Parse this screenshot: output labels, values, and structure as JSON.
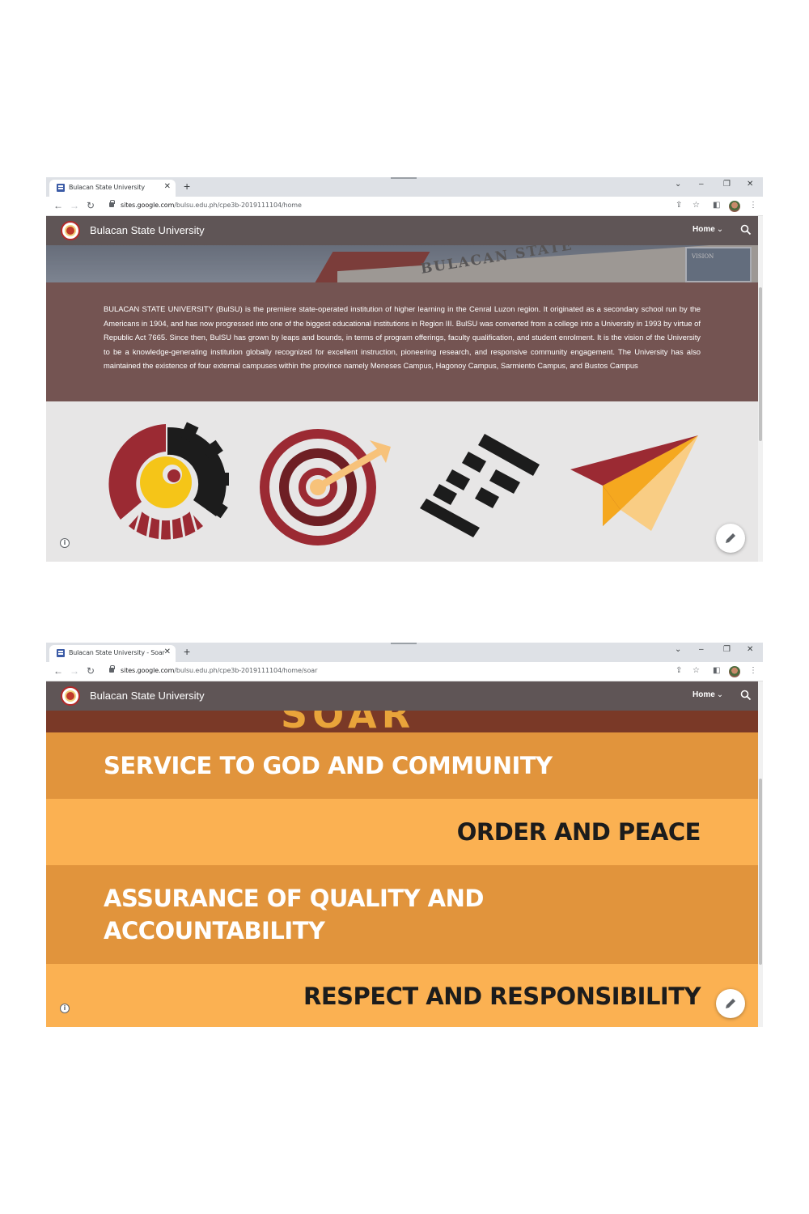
{
  "screenshot1": {
    "tab_title": "Bulacan State University",
    "url_host": "sites.google.com",
    "url_path": "/bulsu.edu.ph/cpe3b-2019111104/home",
    "site_title": "Bulacan State University",
    "nav_home": "Home",
    "banner_word": "BULACAN STATE",
    "banner_sign": "VISION",
    "about_text": "BULACAN STATE UNIVERSITY (BulSU) is the premiere state-operated institution of higher learning in the Cenral Luzon region. It originated as a secondary school run by the Americans in 1904, and has now progressed into one of the biggest educational institutions in Region III. BulSU was converted from a college into a University in 1993 by virtue of Republic Act 7665. Since then, BulSU has grown by leaps and bounds, in terms of program offerings, faculty qualification, and student enrolment. It is the vision of the University to be a knowledge-generating institution globally recognized for excellent instruction, pioneering research, and responsive community engagement. The University has also maintained the existence of four external campuses within the province namely Meneses Campus, Hagonoy Campus, Sarmiento Campus, and Bustos Campus",
    "icons": [
      "vision-gear-icon",
      "target-icon",
      "stairs-icon",
      "paper-plane-icon"
    ]
  },
  "screenshot2": {
    "tab_title": "Bulacan State University - Soar",
    "url_host": "sites.google.com",
    "url_path": "/bulsu.edu.ph/cpe3b-2019111104/home/soar",
    "site_title": "Bulacan State University",
    "nav_home": "Home",
    "header_word": "SOAR",
    "values": [
      "SERVICE TO GOD AND COMMUNITY",
      "ORDER AND PEACE",
      "ASSURANCE OF QUALITY AND ACCOUNTABILITY",
      "RESPECT AND RESPONSIBILITY"
    ]
  },
  "colors": {
    "header": "#5f5556",
    "about_bg": "#745452",
    "maroon": "#9b2a33",
    "gold": "#f5c518",
    "orange_dark": "#e1943c",
    "orange_light": "#fbb152"
  }
}
